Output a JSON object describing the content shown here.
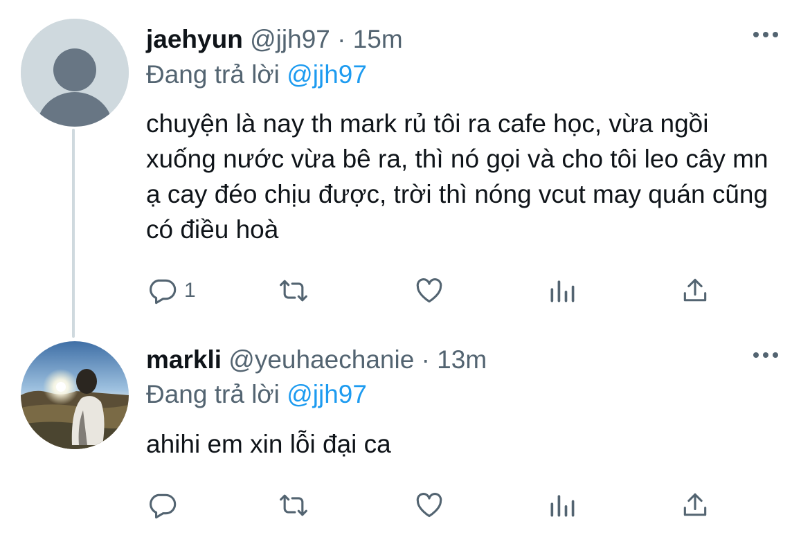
{
  "tweets": [
    {
      "name": "jaehyun",
      "handle": "@jjh97",
      "separator": "·",
      "time": "15m",
      "reply_prefix": "Đang trả lời",
      "reply_to": "@jjh97",
      "text": "chuyện là nay th mark rủ tôi ra cafe học, vừa ngồi xuống nước vừa bê ra, thì nó gọi và cho tôi leo cây mn ạ cay đéo chịu được, trời thì nóng vcut may quán cũng có điều hoà",
      "reply_count": "1",
      "avatar": "default-avatar"
    },
    {
      "name": "markli",
      "handle": "@yeuhaechanie",
      "separator": "·",
      "time": "13m",
      "reply_prefix": "Đang trả lời",
      "reply_to": "@jjh97",
      "text": "ahihi em xin lỗi đại ca",
      "reply_count": "",
      "avatar": "sunset-photo-avatar"
    }
  ],
  "icons": [
    "reply-icon",
    "retweet-icon",
    "like-icon",
    "stats-icon",
    "share-icon",
    "more-icon"
  ],
  "colors": {
    "accent": "#1d9bf0",
    "secondary_text": "#536471",
    "icon": "#536471",
    "thread_line": "#cfd9de"
  }
}
